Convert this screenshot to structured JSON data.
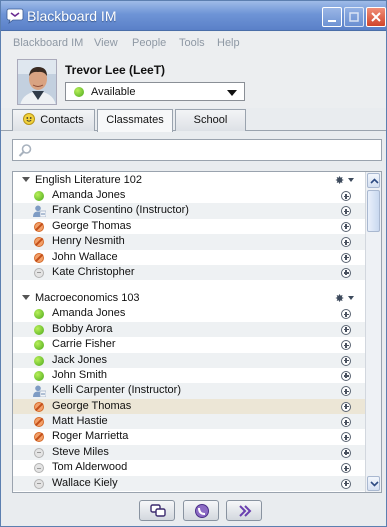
{
  "window": {
    "title": "Blackboard IM"
  },
  "menu": [
    "Blackboard IM",
    "View",
    "People",
    "Tools",
    "Help"
  ],
  "profile": {
    "name": "Trevor Lee (LeeT)",
    "status": "Available"
  },
  "tabs": [
    {
      "label": "Contacts",
      "icon": "smiley-icon"
    },
    {
      "label": "Classmates"
    },
    {
      "label": "School"
    }
  ],
  "active_tab": "Classmates",
  "search": {
    "placeholder": "",
    "icon": "search-icon"
  },
  "groups": [
    {
      "name": "English Literature 102",
      "members": [
        {
          "name": "Amanda Jones",
          "status": "available"
        },
        {
          "name": "Frank Cosentino (Instructor)",
          "status": "instructor"
        },
        {
          "name": "George Thomas",
          "status": "busy"
        },
        {
          "name": "Henry Nesmith",
          "status": "busy"
        },
        {
          "name": "John Wallace",
          "status": "busy"
        },
        {
          "name": "Kate Christopher",
          "status": "offline"
        }
      ]
    },
    {
      "name": "Macroeconomics 103",
      "members": [
        {
          "name": "Amanda Jones",
          "status": "available"
        },
        {
          "name": "Bobby Arora",
          "status": "available"
        },
        {
          "name": "Carrie Fisher",
          "status": "available"
        },
        {
          "name": "Jack Jones",
          "status": "available"
        },
        {
          "name": "John Smith",
          "status": "available"
        },
        {
          "name": "Kelli Carpenter (Instructor)",
          "status": "instructor"
        },
        {
          "name": "George Thomas",
          "status": "busy",
          "highlighted": true
        },
        {
          "name": "Matt Hastie",
          "status": "busy"
        },
        {
          "name": "Roger Marrietta",
          "status": "busy"
        },
        {
          "name": "Steve Miles",
          "status": "offline"
        },
        {
          "name": "Tom Alderwood",
          "status": "offline"
        },
        {
          "name": "Wallace Kiely",
          "status": "offline"
        }
      ]
    }
  ],
  "bottom_buttons": [
    "group-chat-icon",
    "call-icon",
    "forward-icon"
  ],
  "colors": {
    "titlebar": "#6e94d6",
    "available": "#4aa81c",
    "busy": "#f2a06a",
    "offline": "#e4e4e4"
  }
}
